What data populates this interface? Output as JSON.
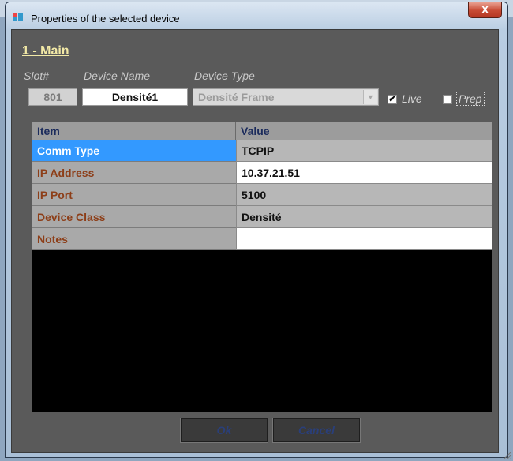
{
  "window": {
    "title": "Properties of the selected device",
    "close_symbol": "X"
  },
  "section": {
    "title": "1 - Main"
  },
  "labels": {
    "slot": "Slot#",
    "device_name": "Device Name",
    "device_type": "Device Type"
  },
  "fields": {
    "slot": "801",
    "device_name": "Densité1",
    "device_type": "Densité Frame"
  },
  "checkboxes": [
    {
      "label": "Live",
      "checked": true
    },
    {
      "label": "Prep",
      "checked": false
    }
  ],
  "grid": {
    "headers": [
      "Item",
      "Value"
    ],
    "rows": [
      {
        "item": "Comm Type",
        "value": "TCPIP"
      },
      {
        "item": "IP Address",
        "value": "10.37.21.51"
      },
      {
        "item": "IP Port",
        "value": "5100"
      },
      {
        "item": "Device Class",
        "value": "Densité"
      },
      {
        "item": "Notes",
        "value": ""
      }
    ]
  },
  "buttons": {
    "ok": "Ok",
    "cancel": "Cancel"
  },
  "colors": {
    "selection": "#3399ff",
    "item_text": "#8d3e18",
    "section_title": "#f2e9a6"
  }
}
